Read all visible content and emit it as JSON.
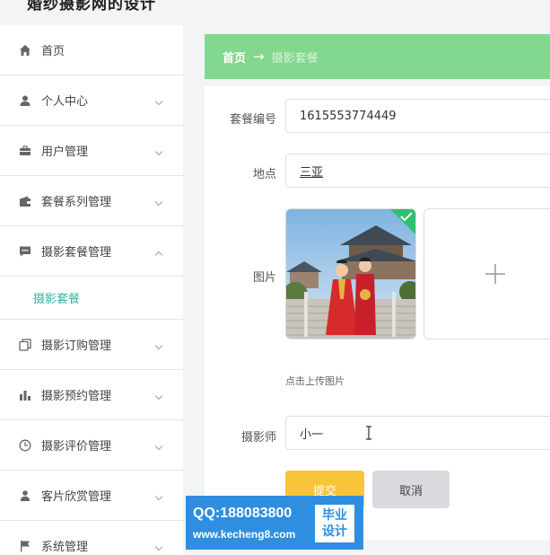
{
  "app": {
    "title": "婚纱摄影网的设计"
  },
  "sidebar": {
    "items": [
      {
        "label": "首页",
        "icon": "home-icon"
      },
      {
        "label": "个人中心",
        "icon": "user-icon"
      },
      {
        "label": "用户管理",
        "icon": "briefcase-icon"
      },
      {
        "label": "套餐系列管理",
        "icon": "wallet-icon"
      },
      {
        "label": "摄影套餐管理",
        "icon": "chat-icon",
        "expanded": true
      },
      {
        "label": "摄影订购管理",
        "icon": "copy-icon"
      },
      {
        "label": "摄影预约管理",
        "icon": "bar-chart-icon"
      },
      {
        "label": "摄影评价管理",
        "icon": "clock-icon"
      },
      {
        "label": "客片欣赏管理",
        "icon": "person-icon"
      },
      {
        "label": "系统管理",
        "icon": "flag-icon"
      }
    ],
    "submenu_active": "摄影套餐"
  },
  "breadcrumb": {
    "home": "首页",
    "arrow": "→",
    "current": "摄影套餐"
  },
  "form": {
    "package_no_label": "套餐编号",
    "package_no_value": "1615553774449",
    "location_label": "地点",
    "location_value": "三亚",
    "image_label": "图片",
    "upload_hint": "点击上传图片",
    "photographer_label": "摄影师",
    "photographer_value": "小一",
    "submit_label": "提交",
    "cancel_label": "取消"
  },
  "watermark": {
    "qq": "QQ:188083800",
    "url": "www.kecheng8.com",
    "badge_line1": "毕业",
    "badge_line2": "设计"
  },
  "colors": {
    "breadcrumb_bg": "#82d88e",
    "submenu_active": "#3ab0a4",
    "submit_bg": "#f8c43a",
    "watermark_bg": "#2f8ee0"
  }
}
